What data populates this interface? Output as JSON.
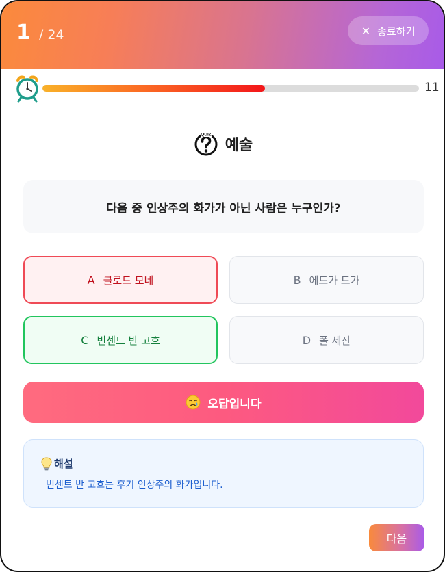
{
  "header": {
    "current": "1",
    "total": "/ 24",
    "exit_label": "종료하기"
  },
  "timer": {
    "remaining": "11",
    "progress": 0.59
  },
  "category": {
    "icon_text": "QUIZ",
    "label": "예술"
  },
  "question": {
    "text": "다음 중 인상주의 화가가 아닌 사람은 누구인가?"
  },
  "options": [
    {
      "letter": "A",
      "text": "클로드 모네",
      "state": "wrong"
    },
    {
      "letter": "B",
      "text": "에드가 드가",
      "state": "neutral"
    },
    {
      "letter": "C",
      "text": "빈센트 반 고흐",
      "state": "correct"
    },
    {
      "letter": "D",
      "text": "폴 세잔",
      "state": "neutral"
    }
  ],
  "result": {
    "label": "오답입니다"
  },
  "explanation": {
    "title": "해설",
    "body": "빈센트 반 고흐는 후기 인상주의 화가입니다."
  },
  "footer": {
    "next_label": "다음"
  },
  "colors": {
    "header_start": "#fb8a3c",
    "header_end": "#a85be8",
    "wrong": "#ef4a56",
    "correct": "#22c55e"
  }
}
